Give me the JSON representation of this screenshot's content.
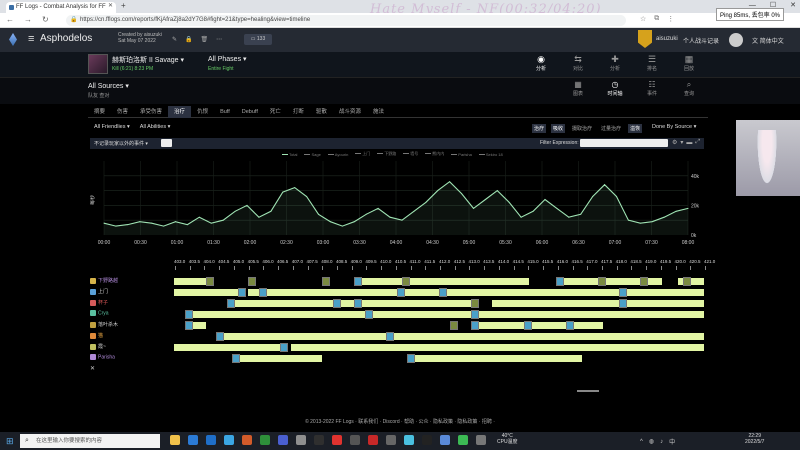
{
  "browser": {
    "tab_title": "FF Logs - Combat Analysis for FF",
    "url": "https://cn.fflogs.com/reports/fKjAfraZj8a2dY7G8#fight=21&type=healing&view=timeline",
    "overlay_title": "Hate Myself - NF(00:32/04:20)",
    "ping_label": "Ping 85ms, 丢包率 0%"
  },
  "site": {
    "title": "Asphodelos",
    "created_by": "Created by aisuzuki",
    "created_date": "Sat May 07 2022",
    "comments_count": "133",
    "user_name": "aisuzuki",
    "user_menu": "个人战斗记录",
    "language": "简体中文"
  },
  "fight": {
    "boss_name": "赫斯珀洛斯 II Savage",
    "boss_kill": "Kill (6:21) 8:23 PM",
    "phases_label": "All Phases",
    "phases_sub": "Entire Fight"
  },
  "top_nav": [
    {
      "label": "分析",
      "icon": "eye-icon"
    },
    {
      "label": "对比",
      "icon": "compare-icon"
    },
    {
      "label": "分析",
      "icon": "puzzle-icon"
    },
    {
      "label": "排名",
      "icon": "list-icon"
    },
    {
      "label": "回放",
      "icon": "replay-icon"
    }
  ],
  "source": {
    "title": "All Sources",
    "subtitle": "队友 查对"
  },
  "sub_nav": [
    {
      "label": "图表",
      "icon": "chart-icon"
    },
    {
      "label": "时间轴",
      "icon": "clock-icon"
    },
    {
      "label": "事件",
      "icon": "events-icon"
    },
    {
      "label": "查询",
      "icon": "query-icon"
    }
  ],
  "tabs": [
    "摘要",
    "伤害",
    "承受伤害",
    "治疗",
    "仇恨",
    "Buff",
    "Debuff",
    "死亡",
    "打断",
    "驱散",
    "战斗资源",
    "施法"
  ],
  "filters": {
    "friendlies": "All Friendlies",
    "abilities": "All Abilities",
    "done_by": "Done By Source"
  },
  "view_toggles": [
    "治疗",
    "吸收",
    "摄取治疗",
    "过量治疗",
    "溢恢"
  ],
  "graph": {
    "select_label": "不记录玩家以外的事件",
    "filter_label": "Filter Expression:",
    "legend": [
      "Total",
      "Sage",
      "Ayourin",
      "上门",
      "下野路",
      "墙号",
      "熊内内",
      "Parisha",
      "Sekiro 18"
    ],
    "y_ticks": [
      "40k",
      "20k",
      "0k"
    ],
    "y_label": "每秒"
  },
  "chart_data": {
    "type": "area",
    "x_ticks": [
      "00:00",
      "00:30",
      "01:00",
      "01:30",
      "02:00",
      "02:30",
      "03:00",
      "03:30",
      "04:00",
      "04:30",
      "05:00",
      "05:30",
      "06:00",
      "06:30",
      "07:00",
      "07:30",
      "08:00"
    ],
    "ylim": [
      0,
      50
    ],
    "y_unit": "k",
    "series": [
      {
        "name": "Total",
        "color": "#9fe3b3",
        "x": [
          0,
          10,
          20,
          30,
          40,
          50,
          60,
          70,
          80,
          90,
          100,
          110,
          120,
          130,
          140,
          150,
          160,
          170,
          180,
          190,
          200,
          210,
          220,
          230,
          240,
          250,
          260,
          270,
          280,
          290,
          300,
          310,
          320,
          330,
          340,
          350,
          360,
          370,
          380,
          390,
          400,
          410,
          420,
          430,
          440,
          450,
          460,
          470,
          480,
          490
        ],
        "values": [
          8,
          6,
          7,
          9,
          8,
          6,
          9,
          7,
          12,
          8,
          10,
          16,
          20,
          12,
          16,
          29,
          32,
          26,
          14,
          9,
          6,
          9,
          14,
          18,
          12,
          10,
          16,
          22,
          30,
          36,
          28,
          18,
          24,
          30,
          22,
          12,
          16,
          24,
          18,
          12,
          14,
          26,
          34,
          26,
          10,
          8,
          9,
          12,
          16,
          18
        ]
      }
    ]
  },
  "timeline": {
    "ticks": [
      "403.0",
      "403.5",
      "404.0",
      "404.5",
      "405.0",
      "405.5",
      "406.0",
      "406.5",
      "407.0",
      "407.5",
      "408.0",
      "408.5",
      "409.0",
      "409.5",
      "410.0",
      "410.5",
      "411.0",
      "411.5",
      "412.0",
      "412.5",
      "413.0",
      "413.5",
      "414.0",
      "414.5",
      "415.0",
      "415.5",
      "416.0",
      "416.5",
      "417.0",
      "417.5",
      "418.0",
      "418.5",
      "419.0",
      "419.5",
      "420.0",
      "420.5",
      "421.0"
    ],
    "rows": [
      {
        "name": "下野路越",
        "color": "#b08ad8",
        "icon_color": "#d6b44a"
      },
      {
        "name": "上门",
        "color": "#d0d0d0",
        "icon_color": "#5aa0d8"
      },
      {
        "name": "杯子",
        "color": "#e05a5a",
        "icon_color": "#d65a5a"
      },
      {
        "name": "Crya",
        "color": "#5ac0a0",
        "icon_color": "#5ac0a0"
      },
      {
        "name": "落叶杀木",
        "color": "#d0d0d0",
        "icon_color": "#c0a040"
      },
      {
        "name": "猫",
        "color": "#e0a040",
        "icon_color": "#e08a3a"
      },
      {
        "name": "霞~",
        "color": "#d0d0d0",
        "icon_color": "#c0c060"
      },
      {
        "name": "Parisha",
        "color": "#b08ad8",
        "icon_color": "#b08ad8"
      },
      {
        "name": "",
        "color": "#d0d0d0",
        "icon_color": "#888888"
      }
    ]
  },
  "footer": "© 2013-2022 FF Logs · 联系我们 · Discord · 帮助 · 公众 · 隐私政策 · 隐私政策 · 招聘 · ",
  "taskbar": {
    "search_placeholder": "在这里输入你要搜索的内容",
    "temp": "40°C",
    "cpu": "CPU温度",
    "time": "22:29",
    "date": "2022/5/7"
  }
}
